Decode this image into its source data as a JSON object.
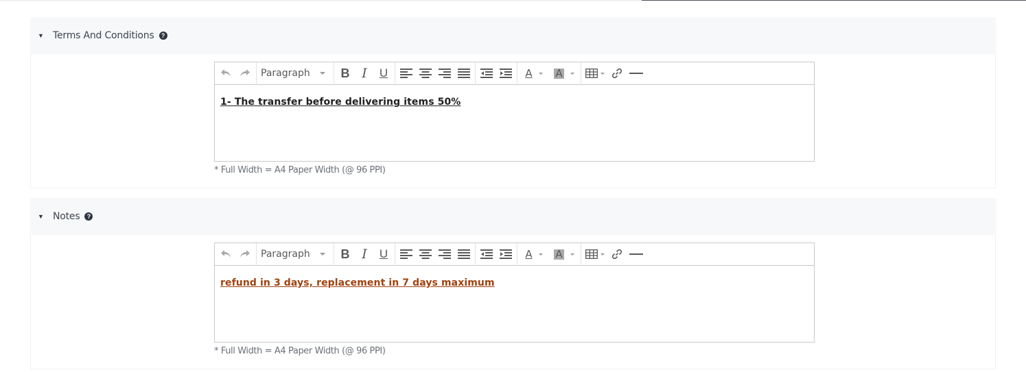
{
  "sections": [
    {
      "title": "Terms And Conditions",
      "editor": {
        "format_label": "Paragraph",
        "content": "1- The transfer before delivering items 50%",
        "content_color": "#1f1f1f"
      },
      "note": "* Full Width = A4 Paper Width (@ 96 PPI)"
    },
    {
      "title": "Notes",
      "editor": {
        "format_label": "Paragraph",
        "content": "refund in 3 days, replacement in 7 days maximum",
        "content_color": "#a0420f"
      },
      "note": "* Full Width = A4 Paper Width (@ 96 PPI)"
    }
  ],
  "toolbar": {
    "undo_icon": "undo-icon",
    "redo_icon": "redo-icon",
    "bold_label": "B",
    "italic_label": "I",
    "underline_label": "U",
    "text_color_label": "A",
    "bg_color_label": "A",
    "accent_bg": "#a9a9a9"
  }
}
